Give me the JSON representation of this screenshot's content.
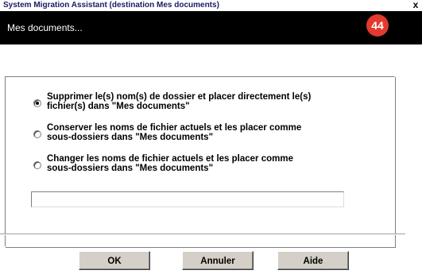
{
  "window": {
    "title": "System Migration Assistant (destination Mes documents)",
    "close_glyph": "x"
  },
  "banner": {
    "heading": "Mes documents...",
    "logo_icon": "sma-logo-icon",
    "logo_text": "44",
    "logo_color": "#e23a2e"
  },
  "options": [
    {
      "line1": "Supprimer le(s) nom(s) de dossier et placer directement le(s)",
      "line2": "fichier(s) dans \"Mes documents\"",
      "selected": true
    },
    {
      "line1": "Conserver les noms de fichier actuels et les placer comme",
      "line2": "sous-dossiers dans \"Mes documents\"",
      "selected": false
    },
    {
      "line1": "Changer les noms de fichier actuels et les placer comme",
      "line2": "sous-dossiers dans \"Mes documents\"",
      "selected": false
    }
  ],
  "text_field": {
    "value": "",
    "placeholder": ""
  },
  "buttons": {
    "ok": "OK",
    "cancel": "Annuler",
    "help": "Aide"
  }
}
